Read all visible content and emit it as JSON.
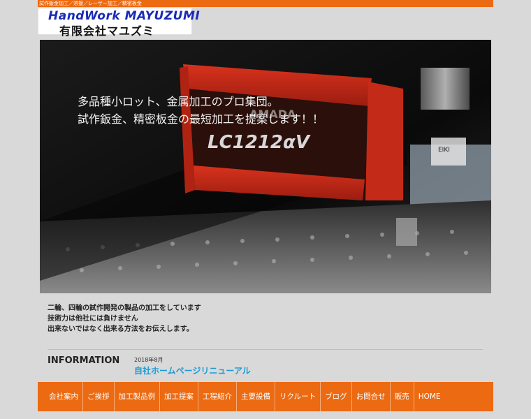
{
  "header": {
    "tagline": "試作鈑金加工／溶接／レーザー加工／精密板金",
    "logo_en": "HandWork MAYUZUMI",
    "logo_jp": "有限会社マユズミ"
  },
  "hero": {
    "line1": "多品種小ロット、金属加工のプロ集団。",
    "line2": "試作鈑金、精密板金の最短加工を提案します！！",
    "machine_model": "LC1212αV",
    "machine_brand": "AMADA",
    "machine_side_label": "EIKI"
  },
  "intro": {
    "line1": "二輪、四輪の試作開発の製品の加工をしています",
    "line2": "技術力は他社には負けません",
    "line3": "出来ないではなく出来る方法をお伝えします。"
  },
  "information": {
    "title": "INFORMATION",
    "date": "2018年8月",
    "link_text": "自社ホームページリニューアル"
  },
  "nav": {
    "items": [
      "会社案内",
      "ご挨拶",
      "加工製品例",
      "加工提案",
      "工程紹介",
      "主要設備",
      "リクルート",
      "ブログ",
      "お問合せ",
      "販売",
      "HOME"
    ]
  },
  "colors": {
    "accent": "#ec6a12",
    "link": "#1a9bd6",
    "logo_blue": "#1a2bb8"
  }
}
